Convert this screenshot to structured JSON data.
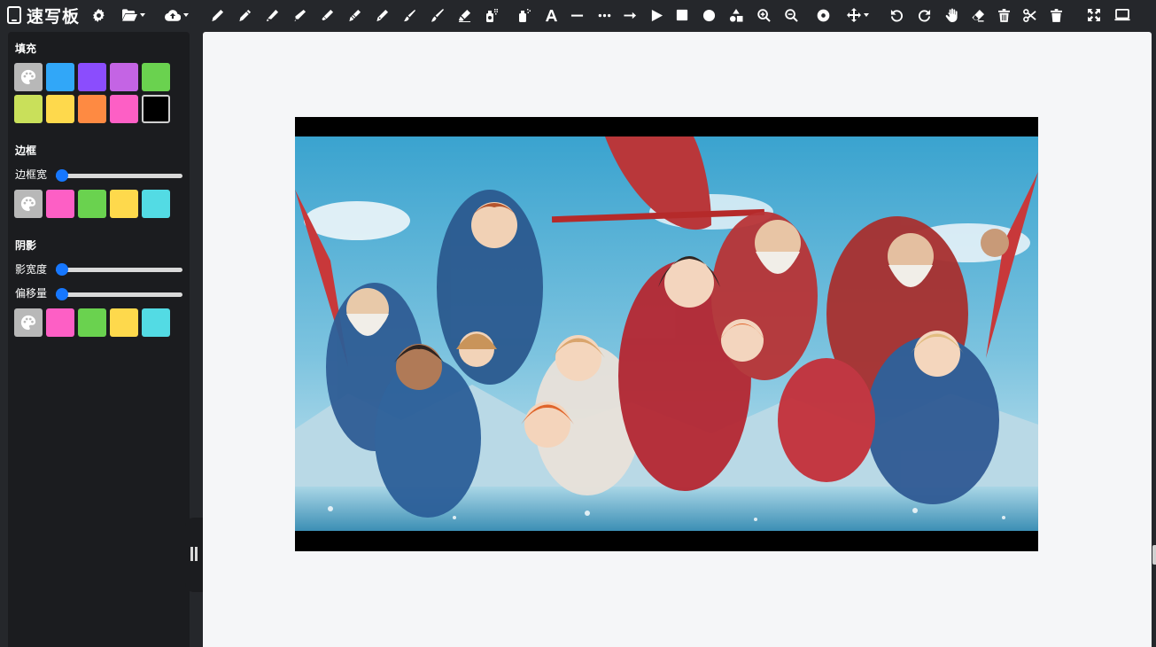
{
  "app": {
    "title": "速写板"
  },
  "toolbar": {
    "tools": [
      {
        "name": "settings-icon"
      },
      {
        "name": "folder-open-icon",
        "dropdown": true
      },
      {
        "name": "cloud-upload-icon",
        "dropdown": true
      },
      {
        "name": "pencil-icon"
      },
      {
        "name": "pen-icon"
      },
      {
        "name": "marker-icon"
      },
      {
        "name": "fine-pen-icon"
      },
      {
        "name": "highlighter-icon"
      },
      {
        "name": "crayon-icon"
      },
      {
        "name": "ink-pen-icon"
      },
      {
        "name": "brush-icon"
      },
      {
        "name": "paint-brush-icon"
      },
      {
        "name": "eraser-pen-icon"
      },
      {
        "name": "spray-can-icon"
      },
      {
        "name": "spray-paint-icon"
      },
      {
        "name": "text-icon"
      },
      {
        "name": "line-icon"
      },
      {
        "name": "dotted-line-icon"
      },
      {
        "name": "arrow-line-icon"
      },
      {
        "name": "triangle-icon"
      },
      {
        "name": "rectangle-icon"
      },
      {
        "name": "circle-icon"
      },
      {
        "name": "shapes-icon"
      },
      {
        "name": "zoom-in-icon"
      },
      {
        "name": "zoom-out-icon"
      },
      {
        "name": "target-icon"
      },
      {
        "name": "move-icon",
        "dropdown": true
      },
      {
        "name": "undo-icon"
      },
      {
        "name": "redo-icon"
      },
      {
        "name": "hand-icon"
      },
      {
        "name": "eraser-icon"
      },
      {
        "name": "trash-icon"
      },
      {
        "name": "scissors-icon"
      },
      {
        "name": "delete-icon"
      },
      {
        "name": "fullscreen-icon"
      },
      {
        "name": "present-icon"
      }
    ]
  },
  "sidebar": {
    "fill": {
      "title": "填充",
      "colors": [
        "#31a7f8",
        "#8b4dfd",
        "#c464e4",
        "#6ad24f",
        "#c9e05a",
        "#fed94c",
        "#fe8a42",
        "#fd5fc5",
        "#000000"
      ],
      "selected": "#000000"
    },
    "border": {
      "title": "边框",
      "width_label": "边框宽",
      "width_value": 0,
      "colors": [
        "#fd5fc5",
        "#6ad24f",
        "#fed94c",
        "#53dbe4"
      ]
    },
    "shadow": {
      "title": "阴影",
      "blur_label": "影宽度",
      "blur_value": 0,
      "offset_label": "偏移量",
      "offset_value": 0,
      "colors": [
        "#fd5fc5",
        "#6ad24f",
        "#fed94c",
        "#53dbe4"
      ]
    }
  },
  "canvas": {
    "background": "#f5f6f8",
    "accent": "#1677ff"
  }
}
